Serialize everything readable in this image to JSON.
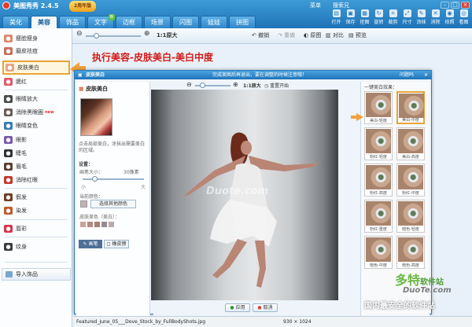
{
  "app": {
    "title": "美图秀秀 2.4.5",
    "badge": "2周年版"
  },
  "topmenu": [
    "菜单",
    "搜索兄",
    "—",
    "□",
    "×"
  ],
  "tabs": [
    {
      "label": "美化",
      "active": false,
      "new": false
    },
    {
      "label": "美容",
      "active": true,
      "new": false
    },
    {
      "label": "饰品",
      "active": false,
      "new": false
    },
    {
      "label": "文字",
      "active": false,
      "new": true
    },
    {
      "label": "边框",
      "active": false,
      "new": false
    },
    {
      "label": "场景",
      "active": false,
      "new": false
    },
    {
      "label": "闪图",
      "active": false,
      "new": false
    },
    {
      "label": "娃娃",
      "active": false,
      "new": false
    },
    {
      "label": "拼图",
      "active": false,
      "new": false
    }
  ],
  "toolbar": [
    "打开",
    "保存",
    "拒图",
    "旋转",
    "裁剪",
    "尺寸",
    "涂抹",
    "消除",
    "拍照",
    "看图"
  ],
  "options": {
    "zoom_label": "1:1原大",
    "undo": "撤销",
    "redo": "重做",
    "original": "原图",
    "compare": "对比",
    "preview": "预览"
  },
  "sidebar": {
    "items": [
      {
        "label": "瘦脸瘦身",
        "icon": "face-slim-icon",
        "color": "#d98b6a",
        "new": false
      },
      {
        "label": "磨皮祛痘",
        "icon": "smooth-skin-icon",
        "color": "#c96f5d",
        "new": false
      },
      {
        "label": "皮肤美白",
        "icon": "skin-whiten-icon",
        "color": "#e4a488",
        "new": false
      },
      {
        "label": "腮红",
        "icon": "blush-icon",
        "color": "#e25a6a",
        "new": false
      },
      {
        "label": "眼睛放大",
        "icon": "eye-enlarge-icon",
        "color": "#4a4a4a",
        "new": false
      },
      {
        "label": "消除黑眼圈",
        "icon": "dark-circle-icon",
        "color": "#6a5d57",
        "new": true
      },
      {
        "label": "眼睛变色",
        "icon": "eye-color-icon",
        "color": "#3a7bb8",
        "new": false
      },
      {
        "label": "眼影",
        "icon": "eyeshadow-icon",
        "color": "#7c5aa6",
        "new": false
      },
      {
        "label": "睫毛",
        "icon": "eyelash-icon",
        "color": "#333333",
        "new": false
      },
      {
        "label": "眉毛",
        "icon": "eyebrow-icon",
        "color": "#5a4030",
        "new": false
      },
      {
        "label": "消除红眼",
        "icon": "red-eye-icon",
        "color": "#c23a2a",
        "new": false
      },
      {
        "label": "假发",
        "icon": "wig-icon",
        "color": "#6b3f25",
        "new": false
      },
      {
        "label": "染发",
        "icon": "hair-dye-icon",
        "color": "#c15a2c",
        "new": false
      },
      {
        "label": "唇彩",
        "icon": "lip-color-icon",
        "color": "#d4364a",
        "new": false
      },
      {
        "label": "纹身",
        "icon": "tattoo-icon",
        "color": "#3c3c3c",
        "new": false
      }
    ],
    "new_tag": "new",
    "import_label": "导入饰品"
  },
  "caption": "执行美容-皮肤美白-美白中度",
  "dialog": {
    "title": "皮肤美白",
    "tip_title": "完成美图后再退出，要在调整的时候注意哦！",
    "help": "问题吗",
    "left_title": "皮肤美白",
    "desc": "点击局部美白，涂抹出需要美白的区域。",
    "settings": "设置：",
    "brush_size": "画笔大小：",
    "brush_value": "30像素",
    "small": "小",
    "big": "大",
    "current_color": "当前颜色：",
    "pick_color": "选择其他颜色",
    "skin_color": "皮肤美色（美白）：",
    "tool_brush": "画笔",
    "tool_eraser": "橡皮擦",
    "zoom_label": "1:1原大",
    "reset": "重置开始",
    "presets_title": "一键美白效果：",
    "presets": [
      {
        "label": "美白-轻度",
        "selected": false
      },
      {
        "label": "美白-中度",
        "selected": true
      },
      {
        "label": "粉红-轻度",
        "selected": false
      },
      {
        "label": "美白-高度",
        "selected": false
      },
      {
        "label": "粉红-高度",
        "selected": false
      },
      {
        "label": "粉红-中度",
        "selected": false
      },
      {
        "label": "粉红-重度",
        "selected": false
      },
      {
        "label": "暗色-轻度",
        "selected": false
      },
      {
        "label": "暗色-中度",
        "selected": false
      },
      {
        "label": "暗色-高度",
        "selected": false
      }
    ],
    "apply": "应用",
    "cancel": "取消",
    "watermark": "Duote.com"
  },
  "statusbar": {
    "file": "Featured_June_05___Dove_Stock_by_FullBodyShots.jpg",
    "size": "930 × 1024"
  },
  "watermark": {
    "brand": "多特",
    "brand2": "软件站",
    "url": "DuoTe.com",
    "slogan": "国内最安全的软件站"
  },
  "colors": {
    "accent": "#1f73b8",
    "highlight": "#e8a435",
    "caption_red": "#d21b16"
  }
}
